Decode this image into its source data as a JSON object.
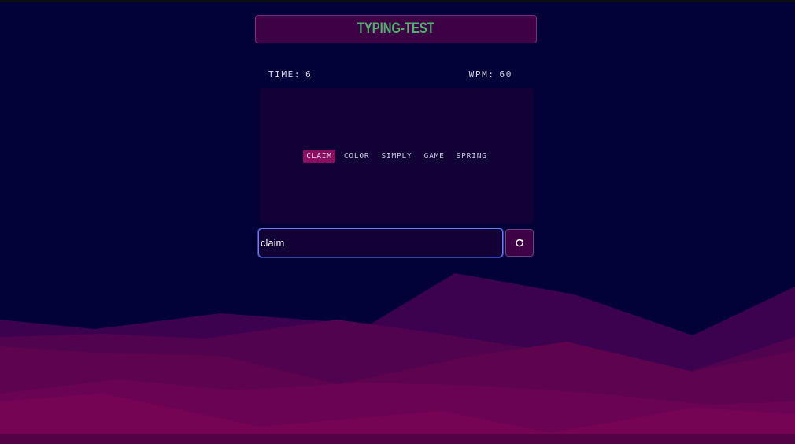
{
  "header": {
    "title": "TYPING-TEST"
  },
  "stats": {
    "time_label": "TIME:",
    "time_value": "6",
    "wpm_label": "WPM:",
    "wpm_value": "60"
  },
  "words": [
    {
      "text": "CLAIM",
      "active": true
    },
    {
      "text": "COLOR",
      "active": false
    },
    {
      "text": "SIMPLY",
      "active": false
    },
    {
      "text": "GAME",
      "active": false
    },
    {
      "text": "SPRING",
      "active": false
    }
  ],
  "input": {
    "value": "claim"
  },
  "reset": {
    "icon": "reload-icon"
  },
  "colors": {
    "background": "#020138",
    "title": "#4fb36d",
    "active_word_bg": "#8a0f63",
    "panel": "#3f0145"
  }
}
